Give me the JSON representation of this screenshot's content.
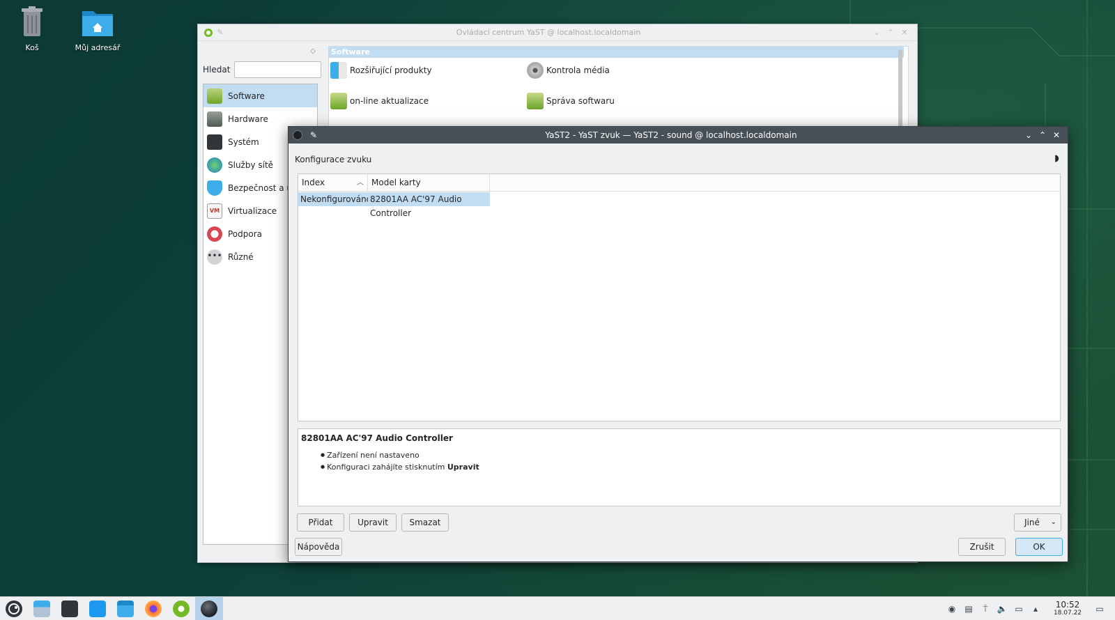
{
  "desktop": {
    "icons": [
      {
        "label": "Koš",
        "icon": "trash-icon"
      },
      {
        "label": "Můj adresář",
        "icon": "home-folder-icon"
      }
    ]
  },
  "control_center": {
    "title": "Ovládací centrum YaST @ localhost.localdomain",
    "search_label": "Hledat",
    "search_value": "",
    "categories": [
      {
        "label": "Software",
        "icon": "software-icon",
        "selected": true
      },
      {
        "label": "Hardware",
        "icon": "hardware-icon"
      },
      {
        "label": "Systém",
        "icon": "system-icon"
      },
      {
        "label": "Služby sítě",
        "icon": "network-services-icon"
      },
      {
        "label": "Bezpečnost a uživ",
        "icon": "security-icon"
      },
      {
        "label": "Virtualizace",
        "icon": "virtualization-icon"
      },
      {
        "label": "Podpora",
        "icon": "support-icon"
      },
      {
        "label": "Různé",
        "icon": "misc-icon"
      }
    ],
    "section_header": "Software",
    "modules": [
      {
        "label": "Rozšiřující produkty",
        "icon": "add-on-products-icon"
      },
      {
        "label": "Kontrola média",
        "icon": "media-check-icon"
      },
      {
        "label": "on-line aktualizace",
        "icon": "online-update-icon"
      },
      {
        "label": "Správa softwaru",
        "icon": "software-management-icon"
      }
    ]
  },
  "dialog": {
    "title": "YaST2 - YaST zvuk — YaST2 - sound @ localhost.localdomain",
    "heading": "Konfigurace zvuku",
    "table": {
      "columns": [
        "Index",
        "Model karty"
      ],
      "rows": [
        [
          "Nekonfigurováno",
          "82801AA AC'97 Audio Controller"
        ]
      ]
    },
    "info": {
      "title": "82801AA AC'97 Audio Controller",
      "line1": "Zařízení není nastaveno",
      "line2_prefix": "Konfiguraci zahájíte stisknutím",
      "line2_bold": "Upravit"
    },
    "buttons": {
      "add": "Přidat",
      "edit": "Upravit",
      "delete": "Smazat",
      "other": "Jiné",
      "help": "Nápověda",
      "cancel": "Zrušit",
      "ok": "OK"
    }
  },
  "taskbar": {
    "clock_time": "10:52",
    "clock_date": "18.07.22"
  },
  "colors": {
    "selection": "#c2dcf1",
    "titlebar_active": "#475057",
    "accent": "#3daee9"
  }
}
